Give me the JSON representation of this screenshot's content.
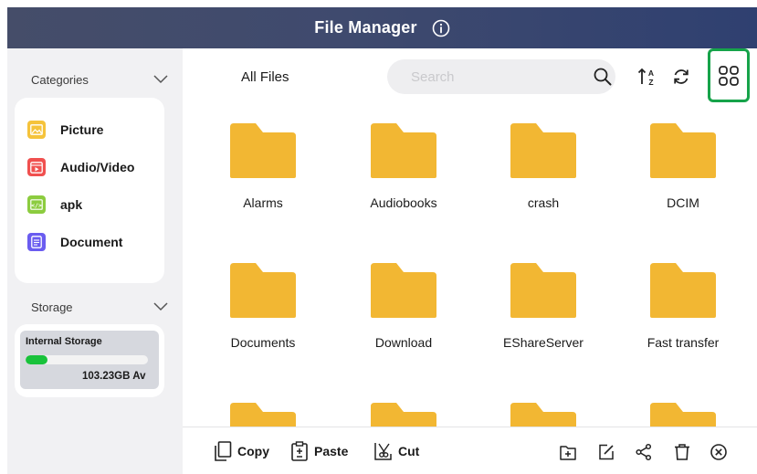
{
  "header": {
    "title": "File Manager",
    "info_icon": "info-circle-icon"
  },
  "sidebar": {
    "categories_label": "Categories",
    "categories": [
      {
        "label": "Picture",
        "icon": "picture-icon",
        "color": "#f5c33b"
      },
      {
        "label": "Audio/Video",
        "icon": "video-icon",
        "color": "#f0504f"
      },
      {
        "label": "apk",
        "icon": "apk-code-icon",
        "color": "#8ccc3f"
      },
      {
        "label": "Document",
        "icon": "document-icon",
        "color": "#6a5cf0"
      }
    ],
    "storage_label": "Storage",
    "storage": {
      "name": "Internal Storage",
      "used_fraction": 0.18,
      "available": "103.23GB Av"
    }
  },
  "toolbar": {
    "location": "All Files",
    "search_placeholder": "Search",
    "sort_icon": "sort-az-icon",
    "refresh_icon": "refresh-icon",
    "view_icon": "grid-view-icon",
    "highlight_color": "#16a34a"
  },
  "files": [
    {
      "name": "Alarms"
    },
    {
      "name": "Audiobooks"
    },
    {
      "name": "crash"
    },
    {
      "name": "DCIM"
    },
    {
      "name": "Documents"
    },
    {
      "name": "Download"
    },
    {
      "name": "EShareServer"
    },
    {
      "name": "Fast transfer"
    },
    {
      "name": ""
    },
    {
      "name": ""
    },
    {
      "name": ""
    },
    {
      "name": ""
    }
  ],
  "folder_color": "#f2b733",
  "actions": {
    "copy": "Copy",
    "paste": "Paste",
    "cut": "Cut",
    "icons": [
      "new-folder-icon",
      "rename-icon",
      "share-icon",
      "delete-icon",
      "close-circle-icon"
    ]
  }
}
